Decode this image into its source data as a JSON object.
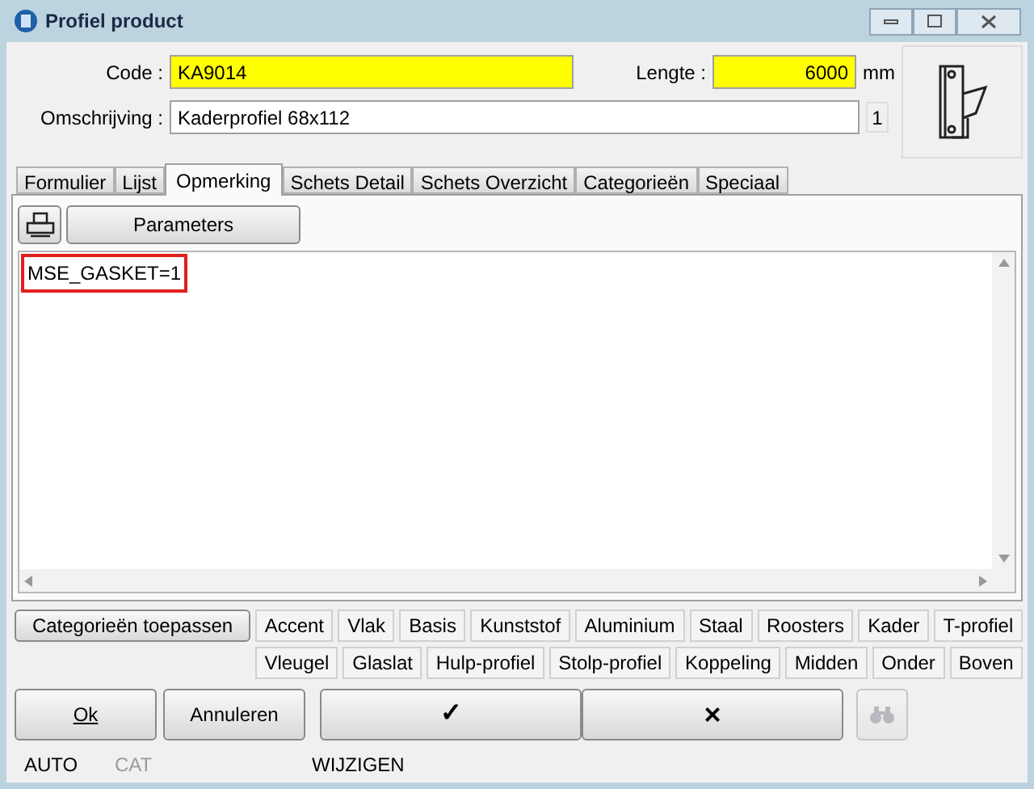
{
  "window": {
    "title": "Profiel product"
  },
  "form": {
    "code_label": "Code :",
    "code_value": "KA9014",
    "length_label": "Lengte :",
    "length_value": "6000",
    "length_unit": "mm",
    "description_label": "Omschrijving :",
    "description_value": "Kaderprofiel 68x112",
    "count": "1"
  },
  "tabs": [
    {
      "label": "Formulier",
      "selected": false
    },
    {
      "label": "Lijst",
      "selected": false
    },
    {
      "label": "Opmerking",
      "selected": true
    },
    {
      "label": "Schets Detail",
      "selected": false
    },
    {
      "label": "Schets Overzicht",
      "selected": false
    },
    {
      "label": "Categorieën",
      "selected": false
    },
    {
      "label": "Speciaal",
      "selected": false
    }
  ],
  "toolbar": {
    "parameters_button": "Parameters"
  },
  "editor": {
    "text": "MSE_GASKET=1",
    "highlighted": true
  },
  "categories": {
    "apply_button": "Categorieën toepassen",
    "row_1": [
      "Accent",
      "Vlak",
      "Basis",
      "Kunststof",
      "Aluminium",
      "Staal",
      "Roosters",
      "Kader",
      "T-profiel"
    ],
    "row_2": [
      "Vleugel",
      "Glaslat",
      "Hulp-profiel",
      "Stolp-profiel",
      "Koppeling",
      "Midden",
      "Onder",
      "Boven"
    ]
  },
  "buttons": {
    "ok": "Ok",
    "cancel": "Annuleren",
    "confirm": "✓",
    "reject": "×",
    "search_disabled": true
  },
  "status_bar": [
    {
      "text": "AUTO",
      "disabled": false
    },
    {
      "text": "CAT",
      "disabled": true
    },
    {
      "text": "WIJZIGEN",
      "disabled": false
    }
  ]
}
